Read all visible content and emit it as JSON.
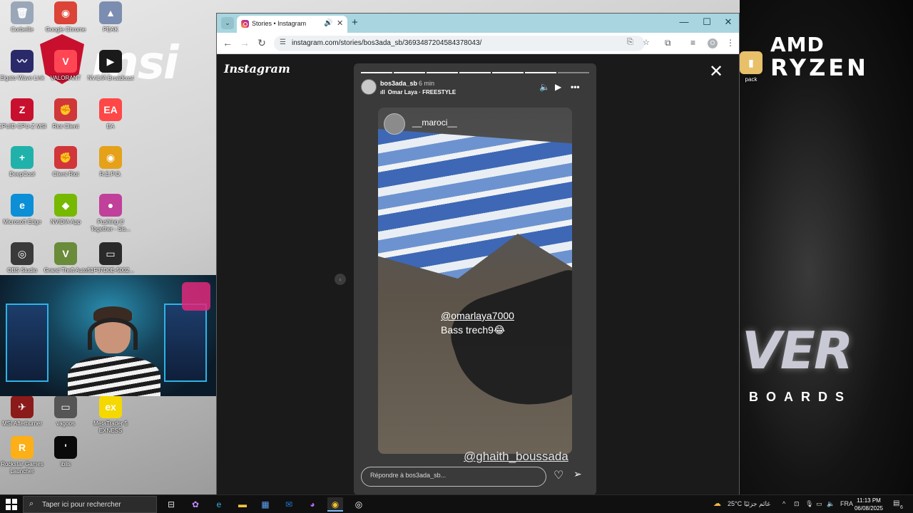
{
  "desktop": {
    "icons": [
      {
        "label": "Corbeille",
        "glyph": "🗑",
        "color": "#9aa7b8"
      },
      {
        "label": "Google Chrome",
        "glyph": "◉",
        "color": "#db4437"
      },
      {
        "label": "PEAK",
        "glyph": "▲",
        "color": "#7b8db0"
      },
      {
        "label": "Elgato Wave Link",
        "glyph": "〰",
        "color": "#2a2a6a"
      },
      {
        "label": "VALORANT",
        "glyph": "V",
        "color": "#ff4655"
      },
      {
        "label": "NVIDIA Broadcast",
        "glyph": "▶",
        "color": "#1a1a1a"
      },
      {
        "label": "CPUID CPU-Z MSI",
        "glyph": "Z",
        "color": "#c8102e"
      },
      {
        "label": "Riot Client",
        "glyph": "✊",
        "color": "#d13639"
      },
      {
        "label": "EA",
        "glyph": "EA",
        "color": "#ff4747"
      },
      {
        "label": "DeepCool",
        "glyph": "+",
        "color": "#20b2aa"
      },
      {
        "label": "Client Riot",
        "glyph": "✊",
        "color": "#d13639"
      },
      {
        "label": "R.E.P.O.",
        "glyph": "◉",
        "color": "#e5a11a"
      },
      {
        "label": "Microsoft Edge",
        "glyph": "e",
        "color": "#0c8fd6"
      },
      {
        "label": "NVIDIA App",
        "glyph": "◆",
        "color": "#76b900"
      },
      {
        "label": "Pushing it! Together - Sis...",
        "glyph": "●",
        "color": "#c0409a"
      },
      {
        "label": "OBS Studio",
        "glyph": "◎",
        "color": "#3a3a3a"
      },
      {
        "label": "Grand Theft Auto",
        "glyph": "V",
        "color": "#6a8b3a"
      },
      {
        "label": "51F37D0E-5002...",
        "glyph": "▭",
        "color": "#2a2a2a"
      },
      {
        "label": "MSI Afterburner",
        "glyph": "✈",
        "color": "#8b1a1a"
      },
      {
        "label": "vagoos",
        "glyph": "▭",
        "color": "#555"
      },
      {
        "label": "MetaTrader 5 EXNESS",
        "glyph": "ex",
        "color": "#f5d800"
      },
      {
        "label": "Rockstar Games Launcher",
        "glyph": "R",
        "color": "#fcaf17"
      },
      {
        "label": "iblis",
        "glyph": "'",
        "color": "#0a0a0a"
      },
      {
        "label": "pack",
        "glyph": "▮",
        "color": "#e8c06a"
      }
    ],
    "wallpaper": {
      "brand_left": "msi",
      "amd": "AMD",
      "ryzen": "RYZEN",
      "ver": "VER",
      "boards": "BOARDS"
    }
  },
  "browser": {
    "tab": {
      "title": "Stories • Instagram"
    },
    "url": "instagram.com/stories/bos3ada_sb/3693487204584378043/",
    "profile_initial": "O"
  },
  "instagram": {
    "logo": "Instagram",
    "story": {
      "username": "bos3ada_sb",
      "time": "6 min",
      "music": "Omar Laya · FREESTYLE",
      "segments": 7,
      "current_segment": 7,
      "media_username": "__maroci__",
      "mention_1": "@omarlaya7000",
      "caption": "Bass trech9😂",
      "mention_2": "@ghaith_boussada",
      "reply_placeholder": "Répondre à bos3ada_sb..."
    }
  },
  "taskbar": {
    "search_placeholder": "Taper ici pour rechercher",
    "weather": "25°C",
    "weather_text": "غائم جزئيًا",
    "language": "FRA",
    "time": "11:13 PM",
    "date": "06/08/2025",
    "notifications": "6"
  }
}
